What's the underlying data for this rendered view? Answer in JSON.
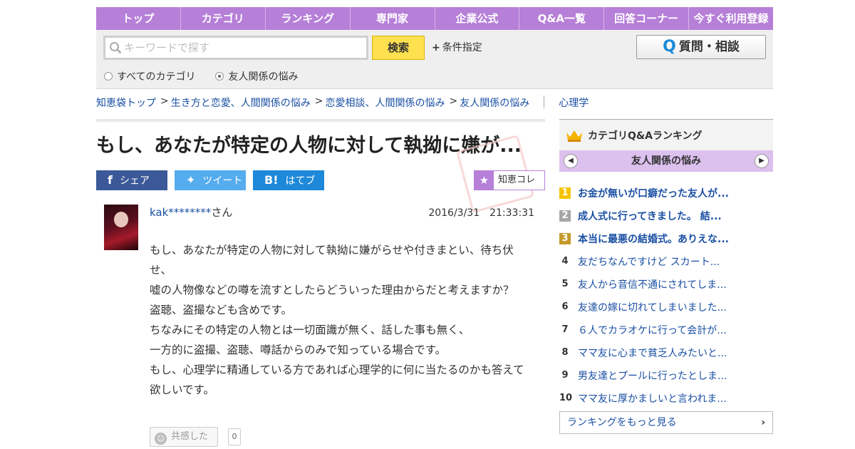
{
  "nav": [
    "トップ",
    "カテゴリ",
    "ランキング",
    "専門家",
    "企業公式",
    "Q&A一覧",
    "回答コーナー",
    "今すぐ利用登録"
  ],
  "search": {
    "placeholder": "キーワードで探す",
    "button": "検索",
    "condition": "条件指定",
    "ask_button": "質問・相談",
    "radio_all": "すべてのカテゴリ",
    "radio_current": "友人関係の悩み"
  },
  "breadcrumb": {
    "items": [
      "知恵袋トップ",
      "生き方と恋愛、人間関係の悩み",
      "恋愛相談、人間関係の悩み",
      "友人関係の悩み"
    ],
    "tag": "心理学"
  },
  "question": {
    "title": "もし、あなたが特定の人物に対して執拗に嫌が...",
    "user": "kak********",
    "san": "さん",
    "date": "2016/3/31　21:33:31",
    "body": [
      "もし、あなたが特定の人物に対して執拗に嫌がらせや付きまとい、待ち伏せ、",
      "嘘の人物像などの噂を流すとしたらどういった理由からだと考えますか？",
      "盗聴、盗撮なども含めです。",
      "ちなみにその特定の人物とは一切面識が無く、話した事も無く、",
      "一方的に盗撮、盗聴、噂話からのみで知っている場合です。",
      "もし、心理学に精通している方であれば心理学的に何に当たるのかも答えて欲しいです。"
    ],
    "empathy_label": "共感した",
    "empathy_count": "0"
  },
  "share": {
    "facebook": "シェア",
    "twitter": "ツイート",
    "hatena": "はてブ",
    "collection": "知恵コレ"
  },
  "sidebar": {
    "title": "カテゴリQ&Aランキング",
    "subtitle": "友人関係の悩み",
    "ranking": [
      {
        "rank": "1",
        "text": "お金が無いが口癖だった友人が..."
      },
      {
        "rank": "2",
        "text": "成人式に行ってきました。 結..."
      },
      {
        "rank": "3",
        "text": "本当に最悪の結婚式。ありえな..."
      },
      {
        "rank": "4",
        "text": "友だちなんですけど スカート..."
      },
      {
        "rank": "5",
        "text": "友人から音信不通にされてしま..."
      },
      {
        "rank": "6",
        "text": "友達の嫁に切れてしまいました..."
      },
      {
        "rank": "7",
        "text": "６人でカラオケに行って会計が..."
      },
      {
        "rank": "8",
        "text": "ママ友に心まで貧乏人みたいと..."
      },
      {
        "rank": "9",
        "text": "男友達とプールに行ったとしま..."
      },
      {
        "rank": "10",
        "text": "ママ友に厚かましいと言われま..."
      }
    ],
    "more": "ランキングをもっと見る"
  },
  "colors": {
    "nav_purple": "#b67fd8",
    "link_blue": "#1a4fa3",
    "search_yellow": "#ffe14f"
  }
}
